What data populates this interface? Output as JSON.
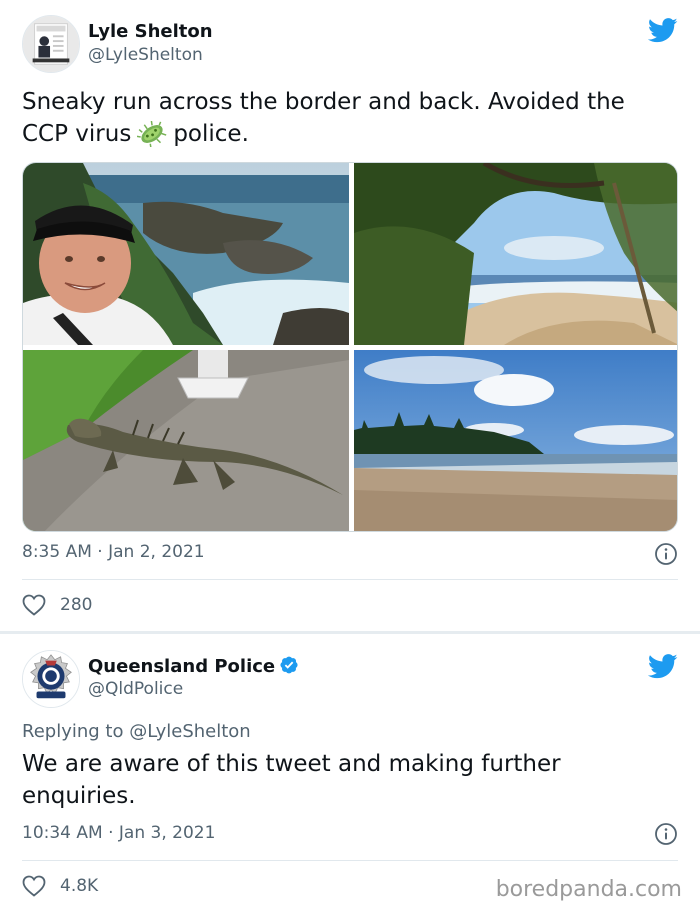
{
  "tweets": [
    {
      "author": {
        "name": "Lyle Shelton",
        "handle": "@LyleShelton"
      },
      "text": {
        "line1": "Sneaky run across the border and back. Avoided the",
        "line2_a": "CCP virus",
        "line2_emoji": "microbe-icon",
        "line2_b": "police."
      },
      "media": [
        {
          "description": "selfie-at-coastline"
        },
        {
          "description": "bush-track-to-beach"
        },
        {
          "description": "water-dragon-lizard"
        },
        {
          "description": "beach-with-pines"
        }
      ],
      "timestamp": "8:35 AM · Jan 2, 2021",
      "likes": "280"
    },
    {
      "author": {
        "name": "Queensland Police",
        "handle": "@QldPolice",
        "verified": true
      },
      "reply_prefix": "Replying to",
      "reply_handle": "@LyleShelton",
      "text": {
        "line1": "We are aware of this tweet and making further",
        "line2": "enquiries."
      },
      "timestamp": "10:34 AM · Jan 3, 2021",
      "likes": "4.8K"
    }
  ],
  "watermark": "boredpanda.com",
  "colors": {
    "twitter_blue": "#1d9bf0",
    "secondary_text": "#536471",
    "primary_text": "#0f1419",
    "divider": "#e1e8ed"
  }
}
